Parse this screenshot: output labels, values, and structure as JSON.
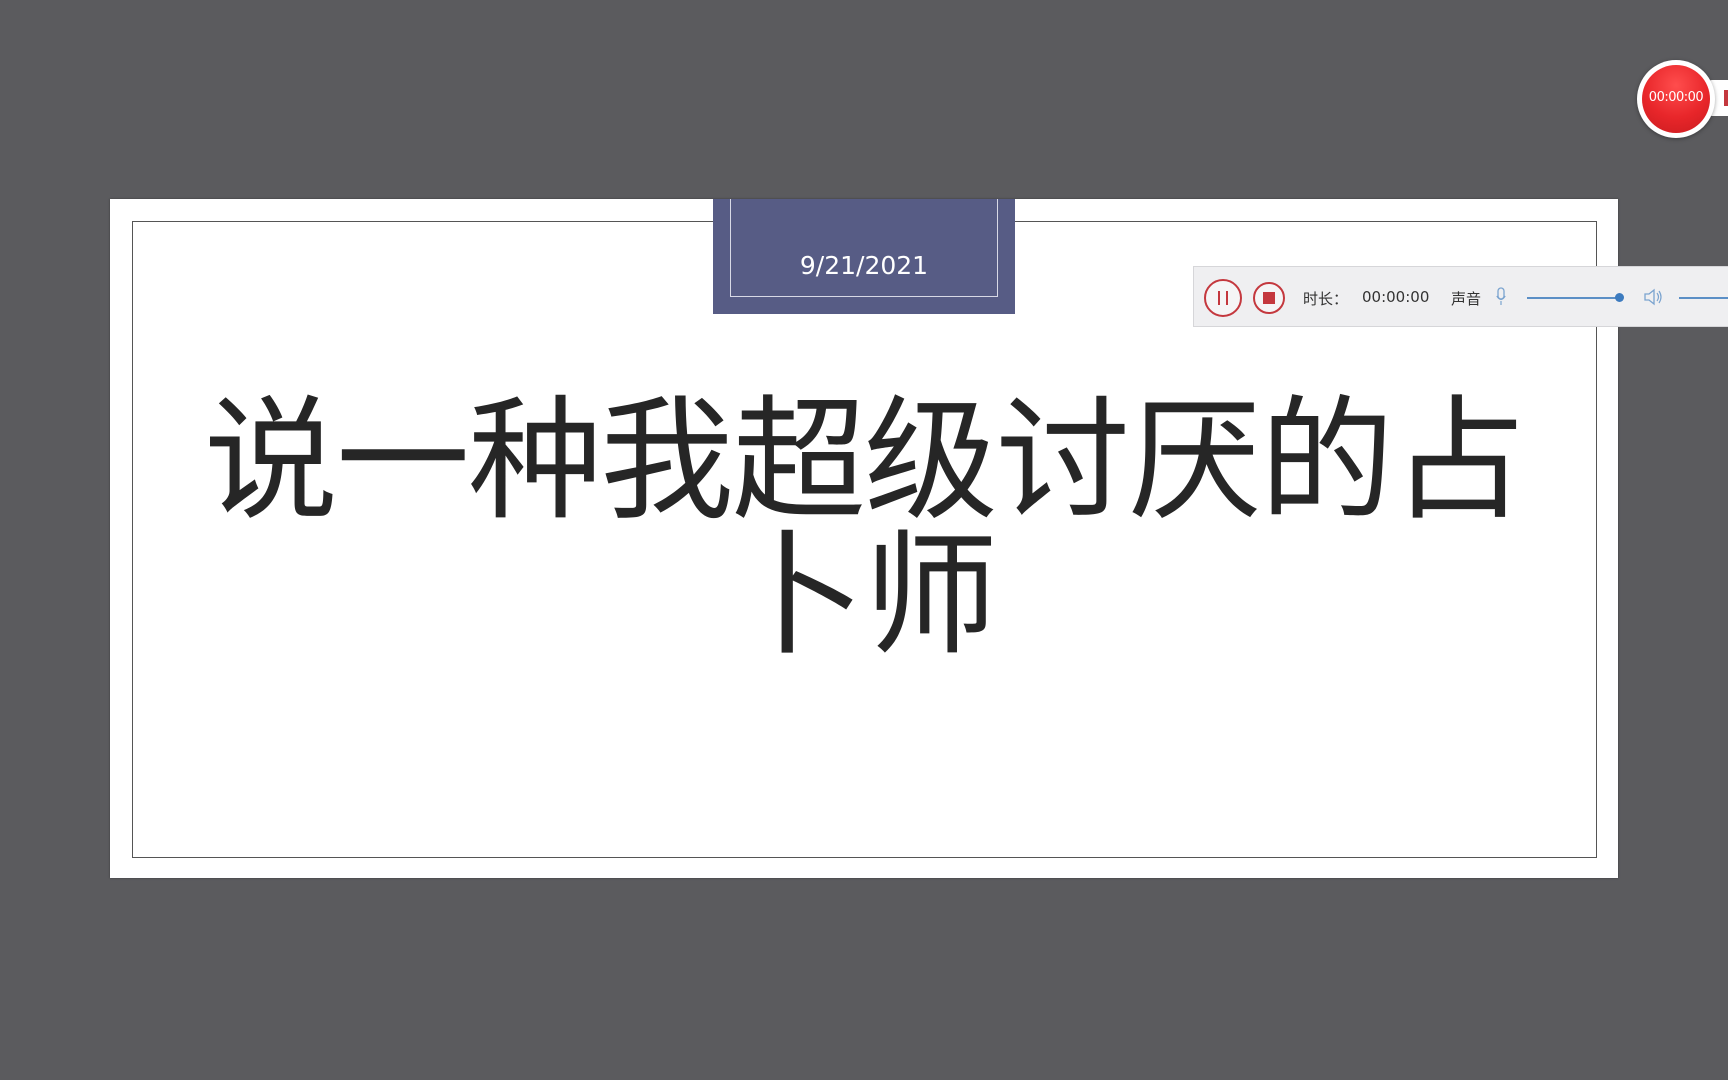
{
  "slide": {
    "date": "9/21/2021",
    "title": "说一种我超级讨厌的占卜师"
  },
  "recording_toolbar": {
    "duration_label": "时长：",
    "duration_value": "00:00:00",
    "sound_label": "声音",
    "mic_level": 0.9,
    "colors": {
      "accent": "#c4383e",
      "slider": "#5b8fc6"
    }
  },
  "record_timer": {
    "time": "00:00:00",
    "color": "#e8262a"
  },
  "icons": [
    "pause-icon",
    "stop-icon",
    "microphone-icon",
    "speaker-icon"
  ]
}
